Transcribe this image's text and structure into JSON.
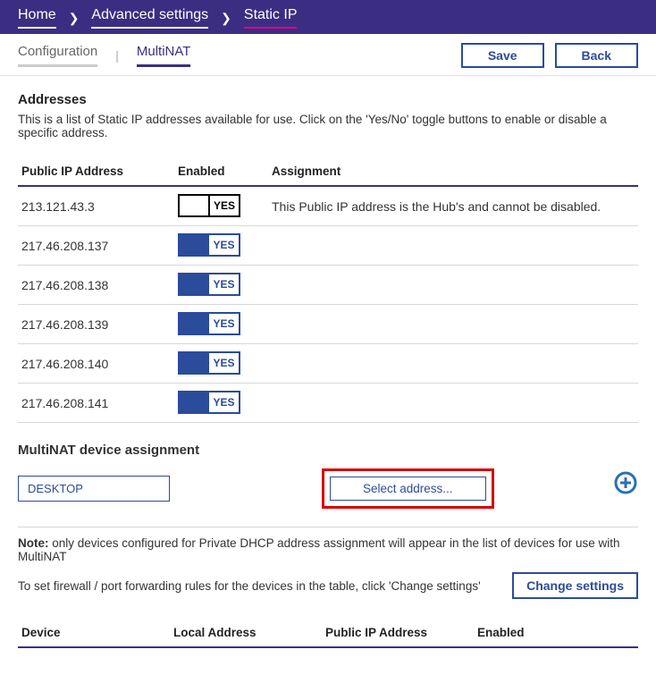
{
  "breadcrumb": {
    "home": "Home",
    "advanced": "Advanced settings",
    "static": "Static IP"
  },
  "tabs": {
    "configuration": "Configuration",
    "multinat": "MultiNAT"
  },
  "buttons": {
    "save": "Save",
    "back": "Back"
  },
  "addresses": {
    "title": "Addresses",
    "desc": "This is a list of Static IP addresses available for use. Click on the 'Yes/No' toggle buttons to enable or disable a specific address.",
    "headers": {
      "ip": "Public IP Address",
      "enabled": "Enabled",
      "assignment": "Assignment"
    },
    "rows": [
      {
        "ip": "213.121.43.3",
        "enabled_label": "YES",
        "assignment": "This Public IP address is the Hub's and cannot be disabled.",
        "locked": true
      },
      {
        "ip": "217.46.208.137",
        "enabled_label": "YES",
        "assignment": "",
        "locked": false
      },
      {
        "ip": "217.46.208.138",
        "enabled_label": "YES",
        "assignment": "",
        "locked": false
      },
      {
        "ip": "217.46.208.139",
        "enabled_label": "YES",
        "assignment": "",
        "locked": false
      },
      {
        "ip": "217.46.208.140",
        "enabled_label": "YES",
        "assignment": "",
        "locked": false
      },
      {
        "ip": "217.46.208.141",
        "enabled_label": "YES",
        "assignment": "",
        "locked": false
      }
    ]
  },
  "assignment": {
    "title": "MultiNAT device assignment",
    "device_value": "DESKTOP",
    "select_address": "Select address..."
  },
  "note": {
    "prefix": "Note:",
    "text": " only devices configured for Private DHCP address assignment will appear in the list of devices for use with MultiNAT"
  },
  "settings": {
    "text": "To set firewall / port forwarding rules for the devices in the table, click 'Change settings'",
    "button": "Change settings"
  },
  "device_table": {
    "headers": {
      "device": "Device",
      "local": "Local Address",
      "public": "Public IP Address",
      "enabled": "Enabled"
    }
  }
}
